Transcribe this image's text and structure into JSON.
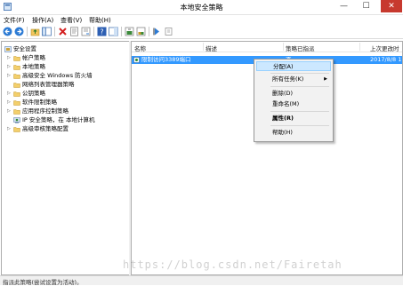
{
  "window": {
    "title": "本地安全策略",
    "min_glyph": "—",
    "max_glyph": "☐",
    "close_glyph": "✕"
  },
  "menu": [
    "文件(F)",
    "操作(A)",
    "查看(V)",
    "帮助(H)"
  ],
  "tree": [
    {
      "label": "安全设置",
      "icon": "security-settings-icon",
      "expanded": true
    },
    {
      "label": "帐户策略",
      "icon": "folder-icon"
    },
    {
      "label": "本地策略",
      "icon": "folder-icon"
    },
    {
      "label": "高级安全 Windows 防火墙",
      "icon": "folder-icon"
    },
    {
      "label": "网络列表管理器策略",
      "icon": "folder-icon"
    },
    {
      "label": "公钥策略",
      "icon": "folder-icon"
    },
    {
      "label": "软件限制策略",
      "icon": "folder-icon"
    },
    {
      "label": "应用程序控制策略",
      "icon": "folder-icon"
    },
    {
      "label": "IP 安全策略，在 本地计算机",
      "icon": "ip-security-icon"
    },
    {
      "label": "高级审核策略配置",
      "icon": "folder-icon"
    }
  ],
  "list": {
    "columns": [
      "名称",
      "描述",
      "策略已指派",
      "上次更改时"
    ],
    "rows": [
      {
        "name": "限制访问3389端口",
        "description": "",
        "assigned": "否",
        "modified": "2017/8/8 1"
      }
    ]
  },
  "context_menu": {
    "items": [
      "分配(A)",
      "所有任务(K)",
      "删除(D)",
      "重命名(M)",
      "属性(R)",
      "帮助(H)"
    ],
    "highlighted": "分配(A)"
  },
  "status": "指派此策略(尝试设置为活动)。",
  "watermark": "https://blog.csdn.net/Fairetah"
}
